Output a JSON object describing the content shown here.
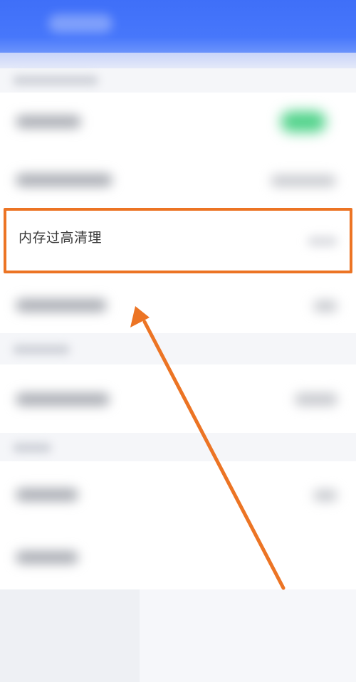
{
  "highlighted_item": {
    "label": "内存过高清理"
  },
  "colors": {
    "app_bar": "#4777fb",
    "highlight": "#ec7424",
    "toggle_on": "#52d38b"
  },
  "icons": {
    "annotation": "arrow-pointing-up-left"
  }
}
